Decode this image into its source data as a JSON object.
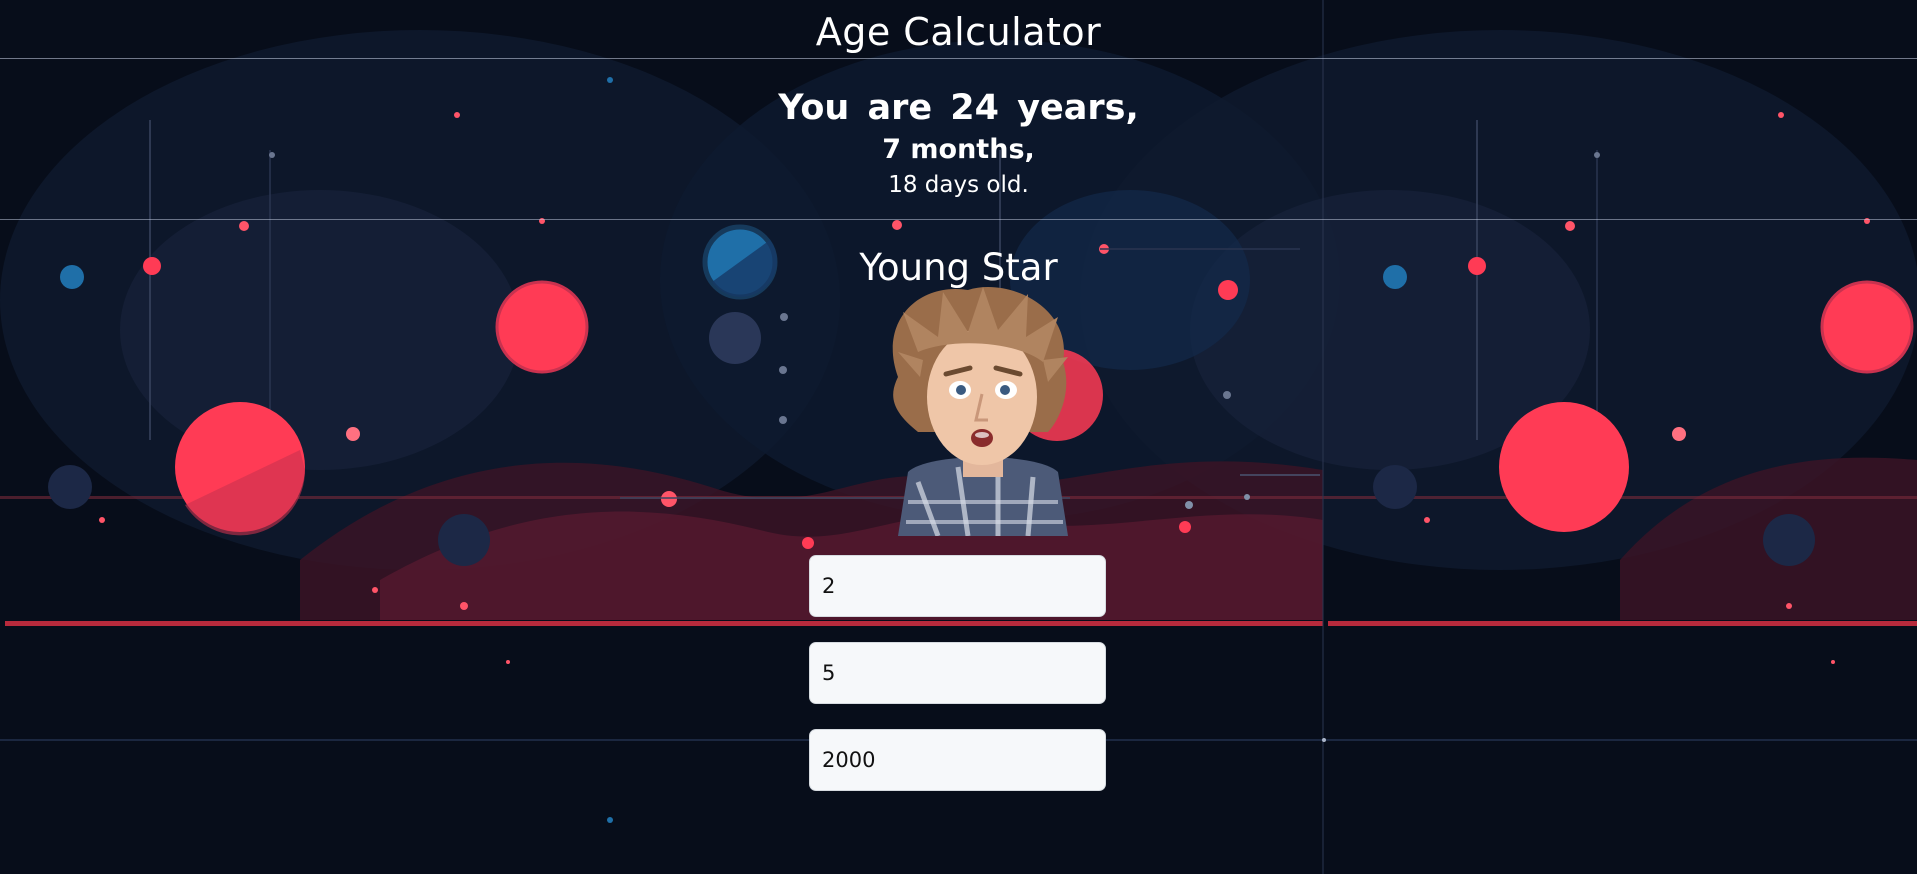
{
  "app": {
    "title": "Age Calculator"
  },
  "result": {
    "years_line": "You are 24 years,",
    "months_line": "7 months,",
    "days_line": "18 days old."
  },
  "category": "Young Star",
  "form": {
    "day_value": "2",
    "month_value": "5",
    "year_value": "2000"
  },
  "colors": {
    "background": "#070d1a",
    "accent_red": "#ff3b55",
    "accent_blue": "#1f6fa8",
    "field_bg": "#f6f8fa"
  }
}
